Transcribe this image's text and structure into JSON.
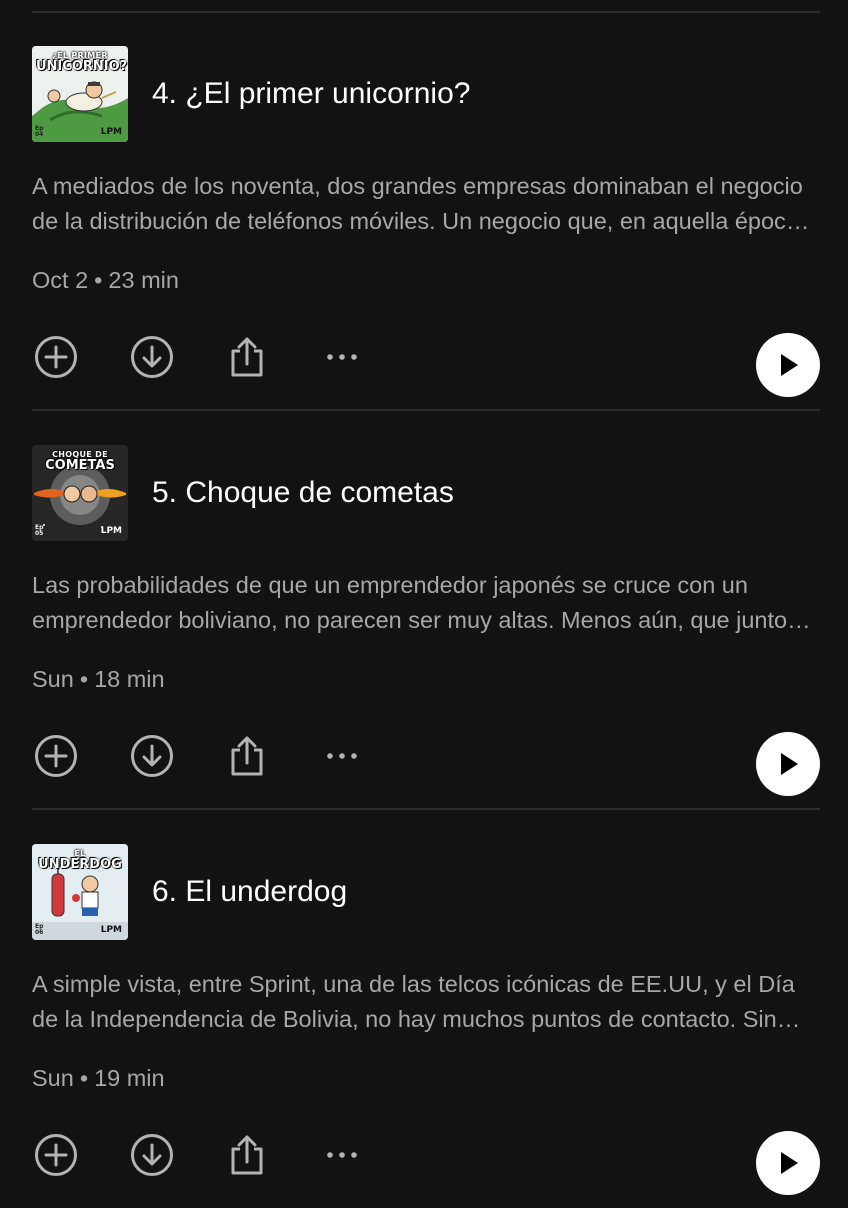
{
  "episodes": [
    {
      "title": "4. ¿El primer unicornio?",
      "description": "A  mediados de los noventa, dos grandes empresas dominaban el negocio de la distribución de teléfonos móviles. Un negocio que, en aquella época, era completamente nuevo.",
      "date": "Oct 2",
      "duration": "23 min",
      "cover": {
        "line1": "¿EL PRIMER",
        "line2": "UNICORNIO?",
        "ep_label": "Ep",
        "ep_number": "04",
        "logo": "LPM",
        "bg": "#ecf1ee",
        "accent": "#3f8f3a"
      }
    },
    {
      "title": "5. Choque de cometas",
      "description": "Las probabilidades de que un emprendedor japonés se cruce con un emprendedor boliviano, no parecen ser muy altas. Menos aún, que juntos cambien una industria.",
      "date": "Sun",
      "duration": "18 min",
      "cover": {
        "line1": "CHOQUE DE",
        "line2": "COMETAS",
        "ep_label": "Ep",
        "ep_number": "05",
        "logo": "LPM",
        "bg": "#2a2a2a",
        "accent": "#e0641e"
      }
    },
    {
      "title": "6. El underdog",
      "description": "A simple vista, entre Sprint, una de las telcos icónicas de EE.UU, y el Día de la Independencia de Bolivia, no hay muchos puntos de contacto. Sin embargo, hay una historia.",
      "date": "Sun",
      "duration": "19 min",
      "cover": {
        "line1": "EL",
        "line2": "UNDERDOG",
        "ep_label": "Ep",
        "ep_number": "06",
        "logo": "LPM",
        "bg": "#e4eef2",
        "accent": "#d23a3a"
      }
    }
  ],
  "meta_separator": "•",
  "icons": {
    "add": "plus-circle-icon",
    "download": "download-circle-icon",
    "share": "share-icon",
    "more": "more-horizontal-icon",
    "play": "play-icon"
  },
  "colors": {
    "background": "#121212",
    "title": "#ffffff",
    "secondary_text": "#a7a7a7",
    "icon": "#b3b3b3",
    "play_button": "#ffffff",
    "divider": "#2c2c2c"
  }
}
